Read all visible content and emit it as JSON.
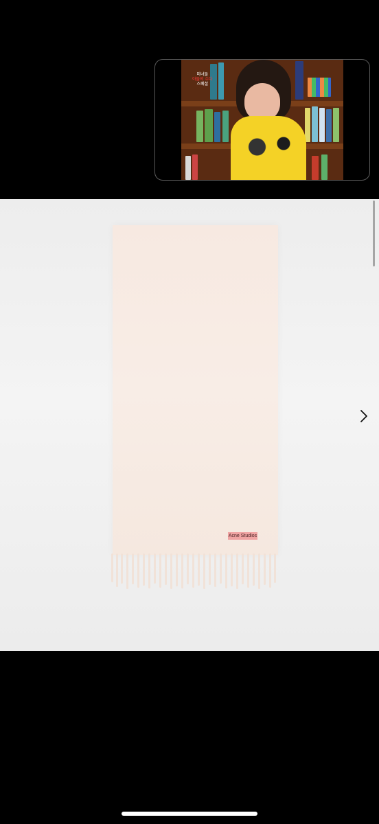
{
  "pip_video": {
    "caption_line1": "미녀들",
    "caption_line2": "아들의 수다",
    "caption_line3": "스폐셜"
  },
  "product": {
    "brand_label": "Acne Studios",
    "accent_colors": {
      "scarf": "#f7e9e1",
      "label": "#f0a4a3",
      "background": "#f0f0f0"
    }
  },
  "icons": {
    "next": "chevron-right-icon"
  }
}
